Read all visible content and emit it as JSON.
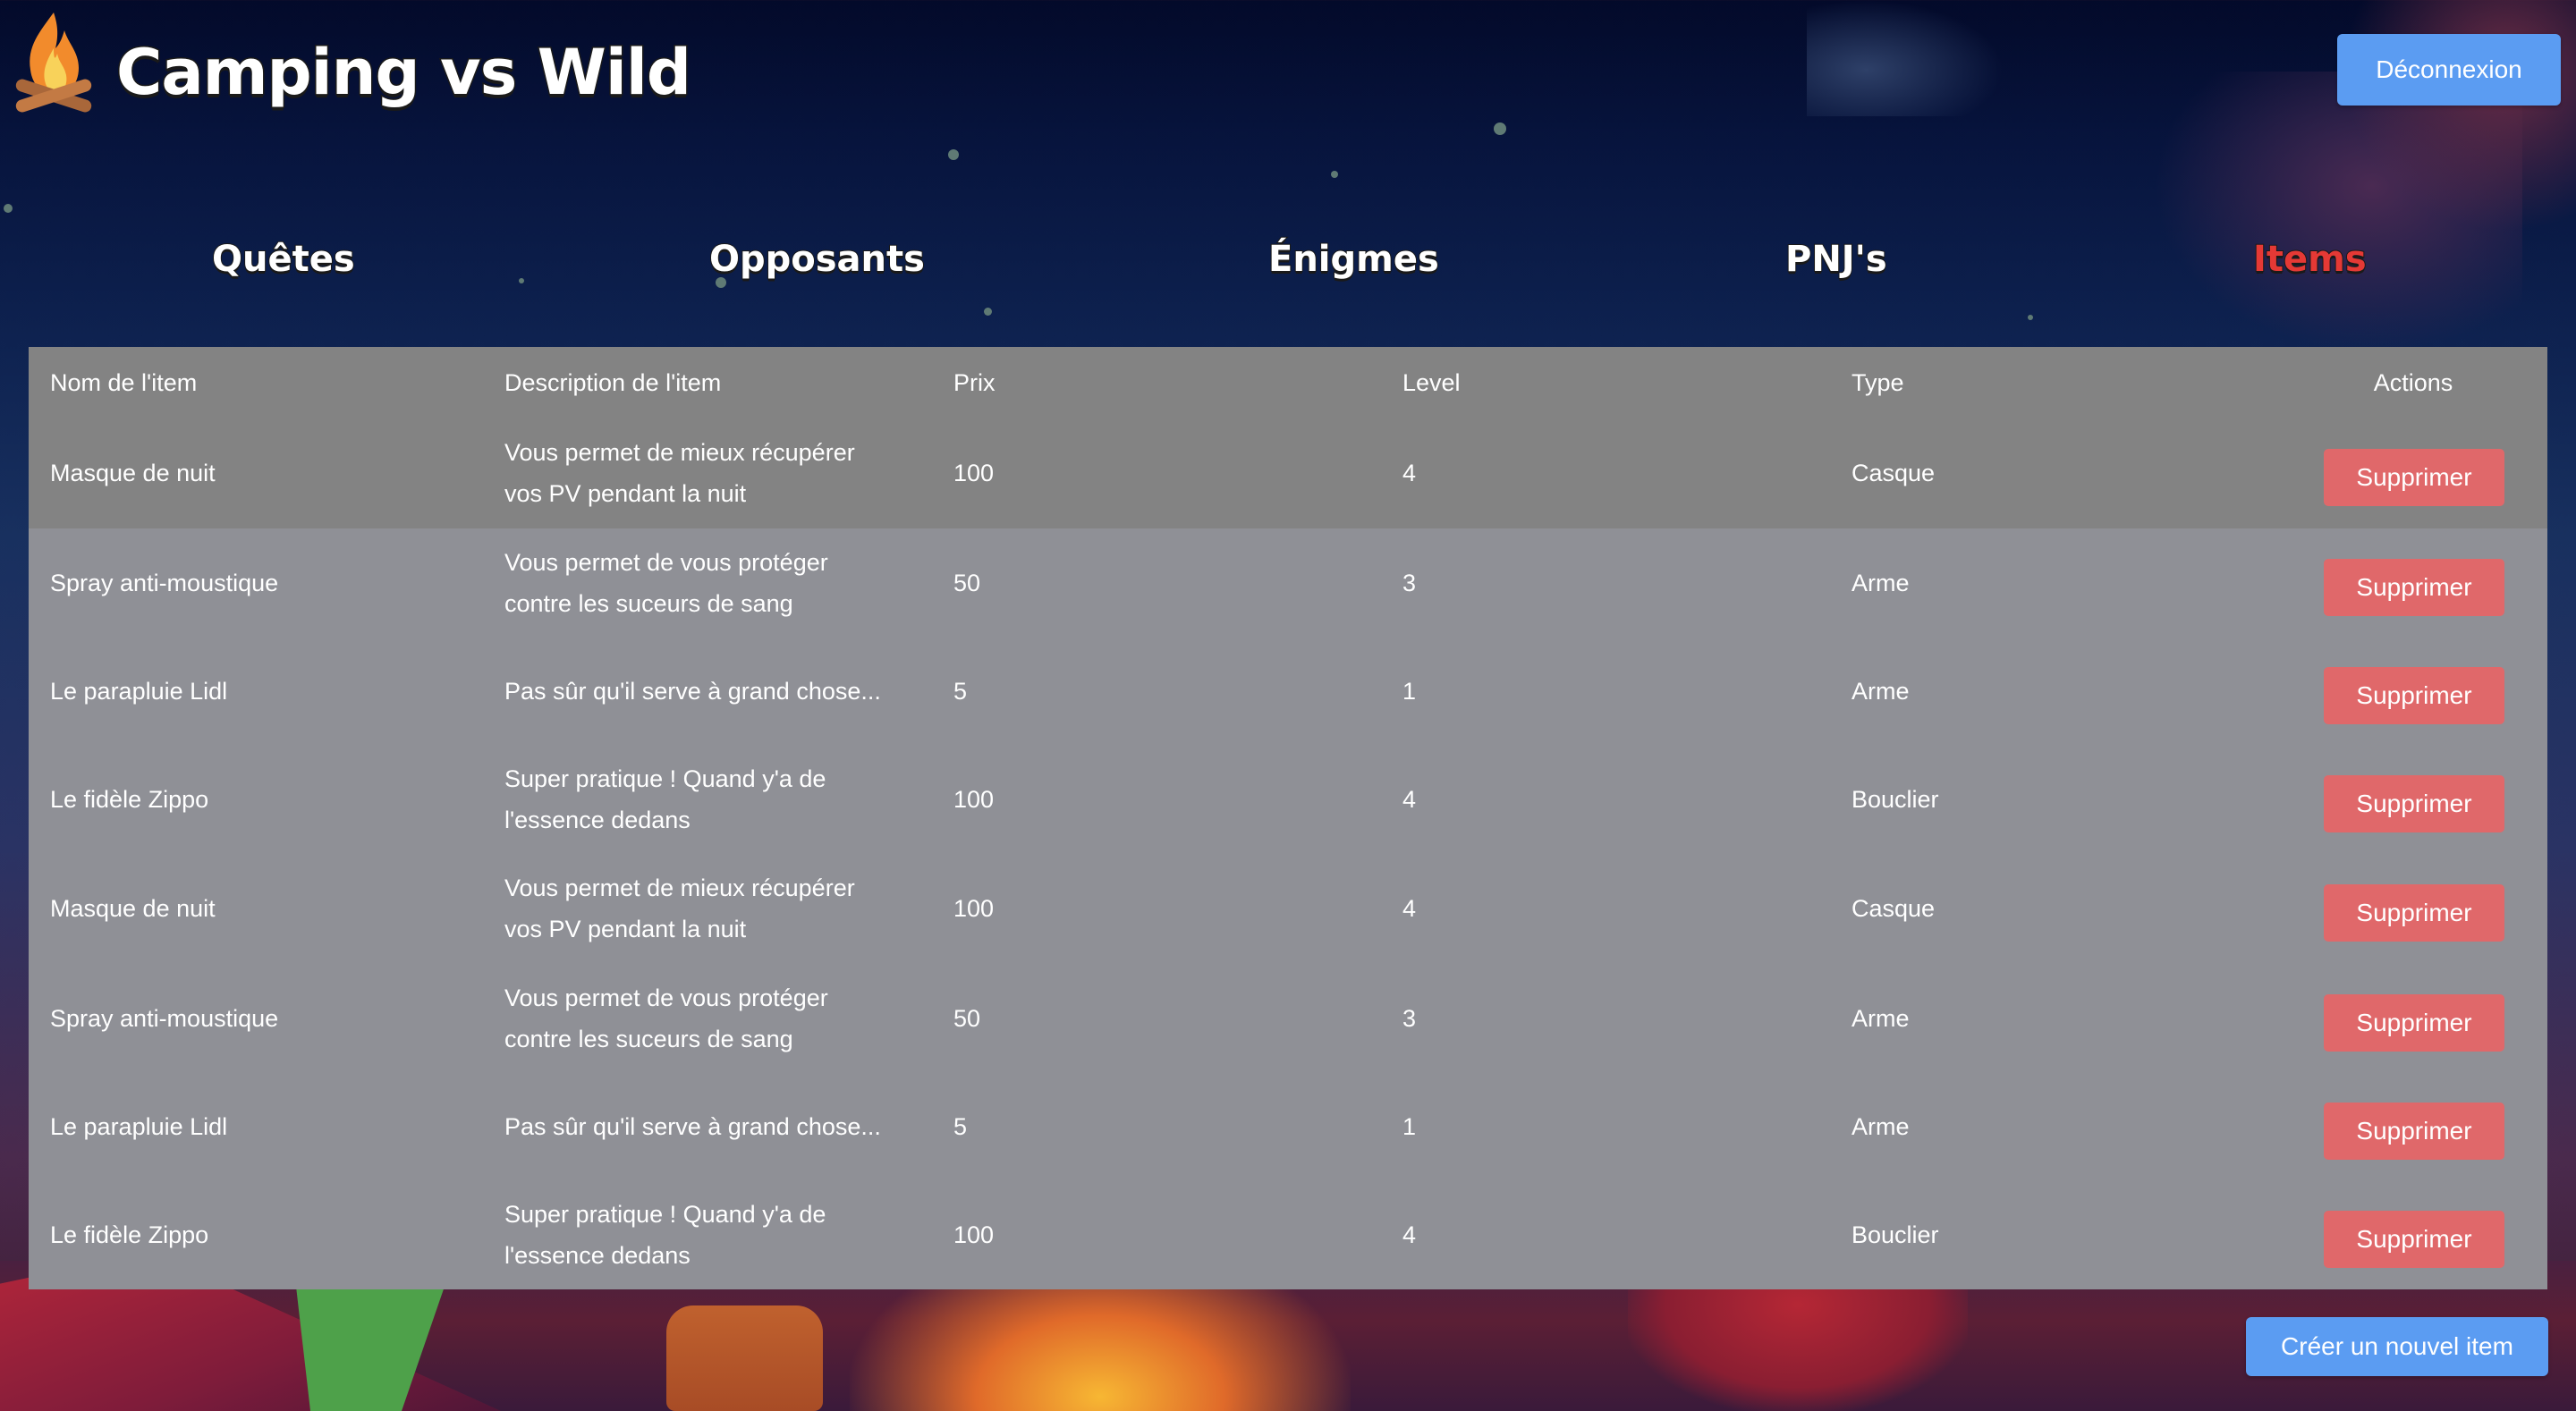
{
  "app": {
    "title": "Camping vs Wild",
    "logo_icon": "campfire-icon",
    "logout_label": "Déconnexion"
  },
  "nav": {
    "items": [
      {
        "label": "Quêtes",
        "active": false
      },
      {
        "label": "Opposants",
        "active": false
      },
      {
        "label": "Énigmes",
        "active": false
      },
      {
        "label": "PNJ's",
        "active": false
      },
      {
        "label": "Items",
        "active": true
      }
    ],
    "active_color": "#e53935"
  },
  "table": {
    "headers": {
      "name": "Nom de l'item",
      "description": "Description de l'item",
      "price": "Prix",
      "level": "Level",
      "type": "Type",
      "actions": "Actions"
    },
    "rows": [
      {
        "name": "Masque de nuit",
        "description": "Vous permet de mieux récupérer vos PV pendant la nuit",
        "price": "100",
        "level": "4",
        "type": "Casque",
        "action": "Supprimer"
      },
      {
        "name": "Spray anti-moustique",
        "description": "Vous permet de vous protéger contre les suceurs de sang",
        "price": "50",
        "level": "3",
        "type": "Arme",
        "action": "Supprimer"
      },
      {
        "name": "Le parapluie Lidl",
        "description": "Pas sûr qu'il serve à grand chose...",
        "price": "5",
        "level": "1",
        "type": "Arme",
        "action": "Supprimer"
      },
      {
        "name": "Le fidèle Zippo",
        "description": "Super pratique ! Quand y'a de l'essence dedans",
        "price": "100",
        "level": "4",
        "type": "Bouclier",
        "action": "Supprimer"
      },
      {
        "name": "Masque de nuit",
        "description": "Vous permet de mieux récupérer vos PV pendant la nuit",
        "price": "100",
        "level": "4",
        "type": "Casque",
        "action": "Supprimer"
      },
      {
        "name": "Spray anti-moustique",
        "description": "Vous permet de vous protéger contre les suceurs de sang",
        "price": "50",
        "level": "3",
        "type": "Arme",
        "action": "Supprimer"
      },
      {
        "name": "Le parapluie Lidl",
        "description": "Pas sûr qu'il serve à grand chose...",
        "price": "5",
        "level": "1",
        "type": "Arme",
        "action": "Supprimer"
      },
      {
        "name": "Le fidèle Zippo",
        "description": "Super pratique ! Quand y'a de l'essence dedans",
        "price": "100",
        "level": "4",
        "type": "Bouclier",
        "action": "Supprimer"
      }
    ]
  },
  "footer": {
    "create_label": "Créer un nouvel item"
  },
  "colors": {
    "primary_button": "#5b9cf2",
    "danger_button": "#e0686a",
    "table_header_bg": "#838383",
    "table_row_bg": "#8f9096"
  }
}
